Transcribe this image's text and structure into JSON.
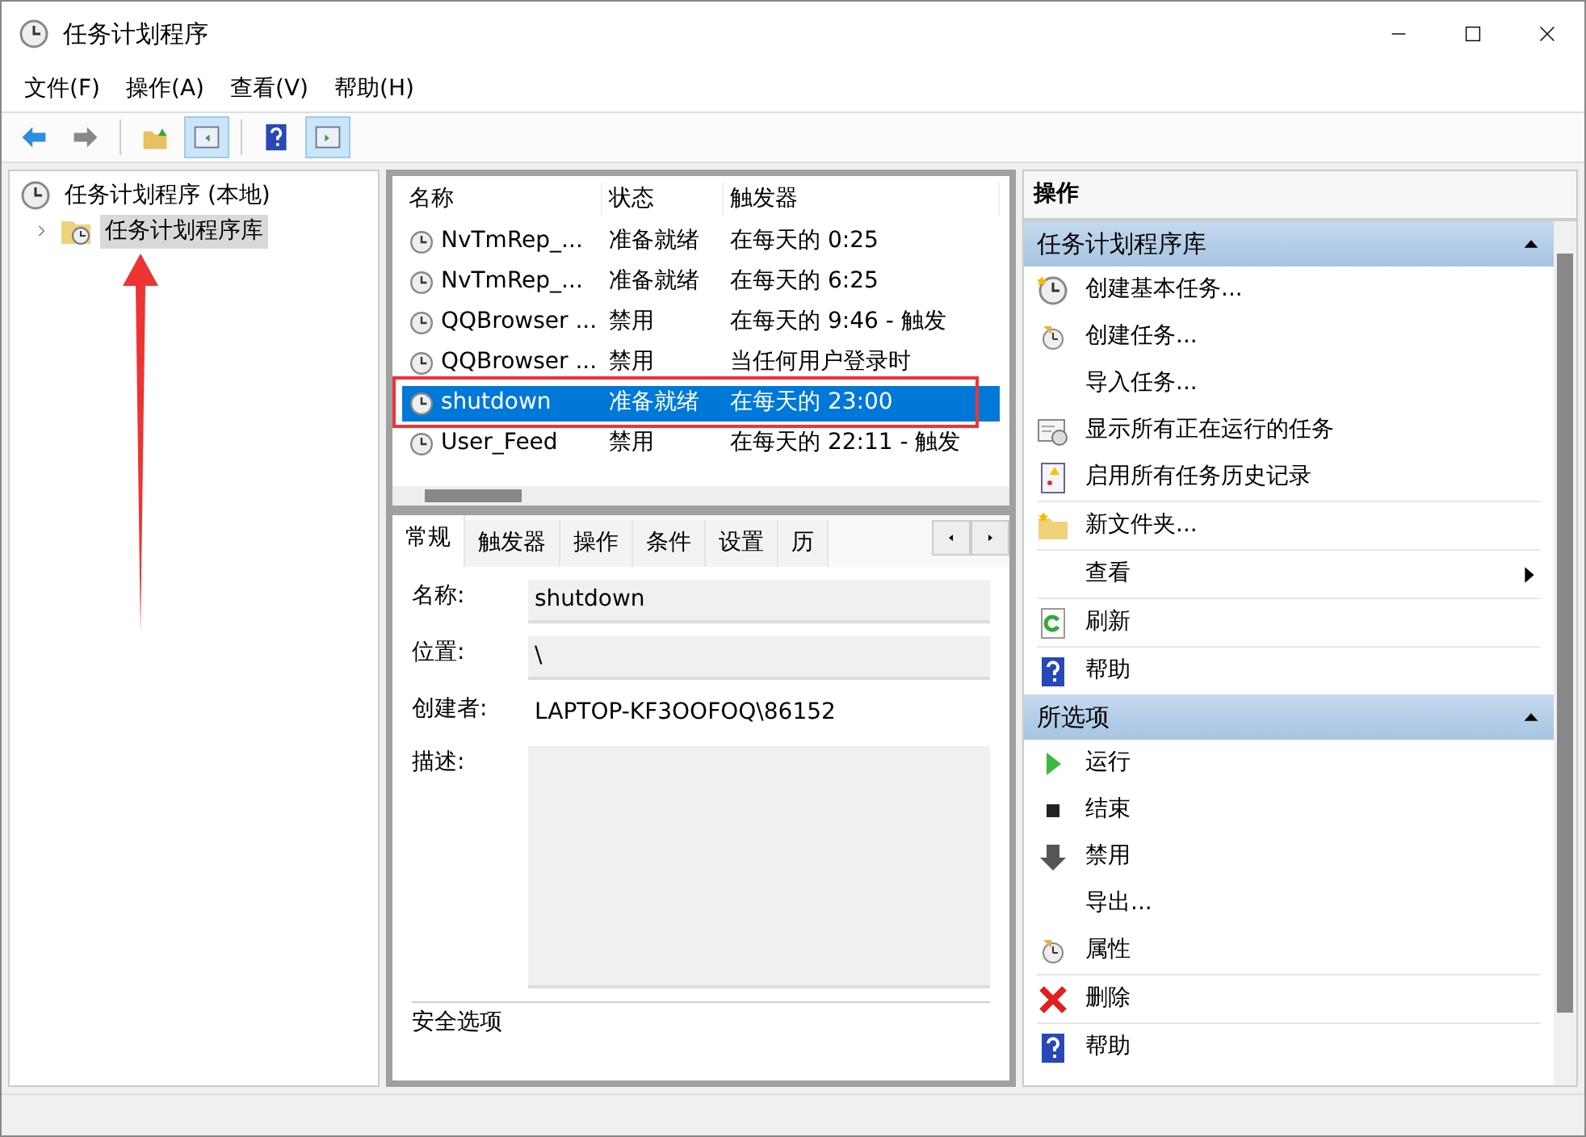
{
  "window": {
    "title": "任务计划程序"
  },
  "menu": [
    "文件(F)",
    "操作(A)",
    "查看(V)",
    "帮助(H)"
  ],
  "toolbar": [
    {
      "kind": "back",
      "pressed": false
    },
    {
      "kind": "forward",
      "pressed": false
    },
    {
      "kind": "up",
      "pressed": false
    },
    {
      "kind": "tree",
      "pressed": true
    },
    {
      "kind": "help",
      "pressed": false
    },
    {
      "kind": "actions",
      "pressed": true
    }
  ],
  "tree": [
    {
      "label": "任务计划程序 (本地)",
      "selected": false,
      "children": [
        {
          "label": "任务计划程序库",
          "expanded": false,
          "selected": true
        }
      ]
    }
  ],
  "task_list": {
    "columns": [
      "名称",
      "状态",
      "触发器"
    ],
    "rows": [
      {
        "name": "NvTmRep_...",
        "status": "准备就绪",
        "trigger": "在每天的 0:25",
        "selected": false
      },
      {
        "name": "NvTmRep_...",
        "status": "准备就绪",
        "trigger": "在每天的 6:25",
        "selected": false
      },
      {
        "name": "QQBrowser ...",
        "status": "禁用",
        "trigger": "在每天的 9:46 - 触发",
        "selected": false
      },
      {
        "name": "QQBrowser ...",
        "status": "禁用",
        "trigger": "当任何用户登录时",
        "selected": false
      },
      {
        "name": "shutdown",
        "status": "准备就绪",
        "trigger": "在每天的 23:00",
        "selected": true
      },
      {
        "name": "User_Feed",
        "status": "禁用",
        "trigger": "在每天的 22:11 - 触发",
        "selected": false
      }
    ]
  },
  "details": {
    "tabs": [
      {
        "label": "常规",
        "selected": true
      },
      {
        "label": "触发器",
        "selected": false
      },
      {
        "label": "操作",
        "selected": false
      },
      {
        "label": "条件",
        "selected": false
      },
      {
        "label": "设置",
        "selected": false
      },
      {
        "label": "历",
        "selected": false
      }
    ],
    "fields": [
      {
        "label": "名称:",
        "value": "shutdown",
        "kind": "input"
      },
      {
        "label": "位置:",
        "value": "\\",
        "kind": "input"
      },
      {
        "label": "创建者:",
        "value": "LAPTOP-KF3OOFOQ\\86152",
        "kind": "text"
      },
      {
        "label": "描述:",
        "kind": "textarea"
      }
    ],
    "section": "安全选项"
  },
  "actions": {
    "title": "操作",
    "groups": [
      {
        "title": "任务计划程序库",
        "expanded": true,
        "items": [
          {
            "label": "创建基本任务...",
            "kind": "create-basic"
          },
          {
            "label": "创建任务...",
            "kind": "create"
          },
          {
            "label": "导入任务...",
            "kind": "plain"
          },
          {
            "label": "显示所有正在运行的任务",
            "kind": "running"
          },
          {
            "label": "启用所有任务历史记录",
            "kind": "history"
          },
          {
            "kind": "separator"
          },
          {
            "label": "新文件夹...",
            "kind": "folder"
          },
          {
            "kind": "separator"
          },
          {
            "label": "查看",
            "kind": "submenu"
          },
          {
            "kind": "separator"
          },
          {
            "label": "刷新",
            "kind": "refresh"
          },
          {
            "kind": "separator"
          },
          {
            "label": "帮助",
            "kind": "help"
          }
        ]
      },
      {
        "title": "所选项",
        "expanded": true,
        "items": [
          {
            "label": "运行",
            "kind": "run"
          },
          {
            "label": "结束",
            "kind": "end"
          },
          {
            "label": "禁用",
            "kind": "disable"
          },
          {
            "label": "导出...",
            "kind": "plain"
          },
          {
            "label": "属性",
            "kind": "properties"
          },
          {
            "kind": "separator"
          },
          {
            "label": "删除",
            "kind": "delete"
          },
          {
            "kind": "separator"
          },
          {
            "label": "帮助",
            "kind": "help"
          }
        ]
      }
    ]
  }
}
